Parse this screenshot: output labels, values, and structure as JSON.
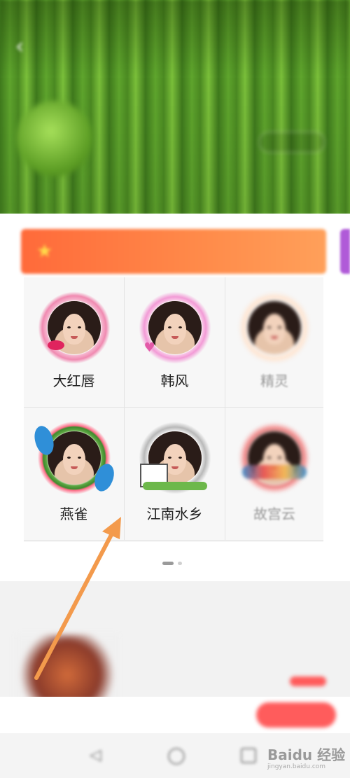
{
  "header": {
    "title": "",
    "description": "",
    "button": ""
  },
  "recommend": {
    "label": ""
  },
  "frames": [
    {
      "name": "大红唇"
    },
    {
      "name": "韩风"
    },
    {
      "name": "精灵"
    },
    {
      "name": "燕雀"
    },
    {
      "name": "江南水乡"
    },
    {
      "name": "故宫云"
    }
  ],
  "activity": {
    "section_title": "",
    "item_title": "",
    "item_meta": ""
  },
  "bottom_bar": {
    "text": "",
    "button": ""
  },
  "watermark": {
    "text": "Baidu 经验",
    "sub": "jingyan.baidu.com"
  },
  "colors": {
    "accent_orange": "#ff7a45",
    "arrow": "#f39a4c",
    "open_button": "#ff5c5c"
  }
}
